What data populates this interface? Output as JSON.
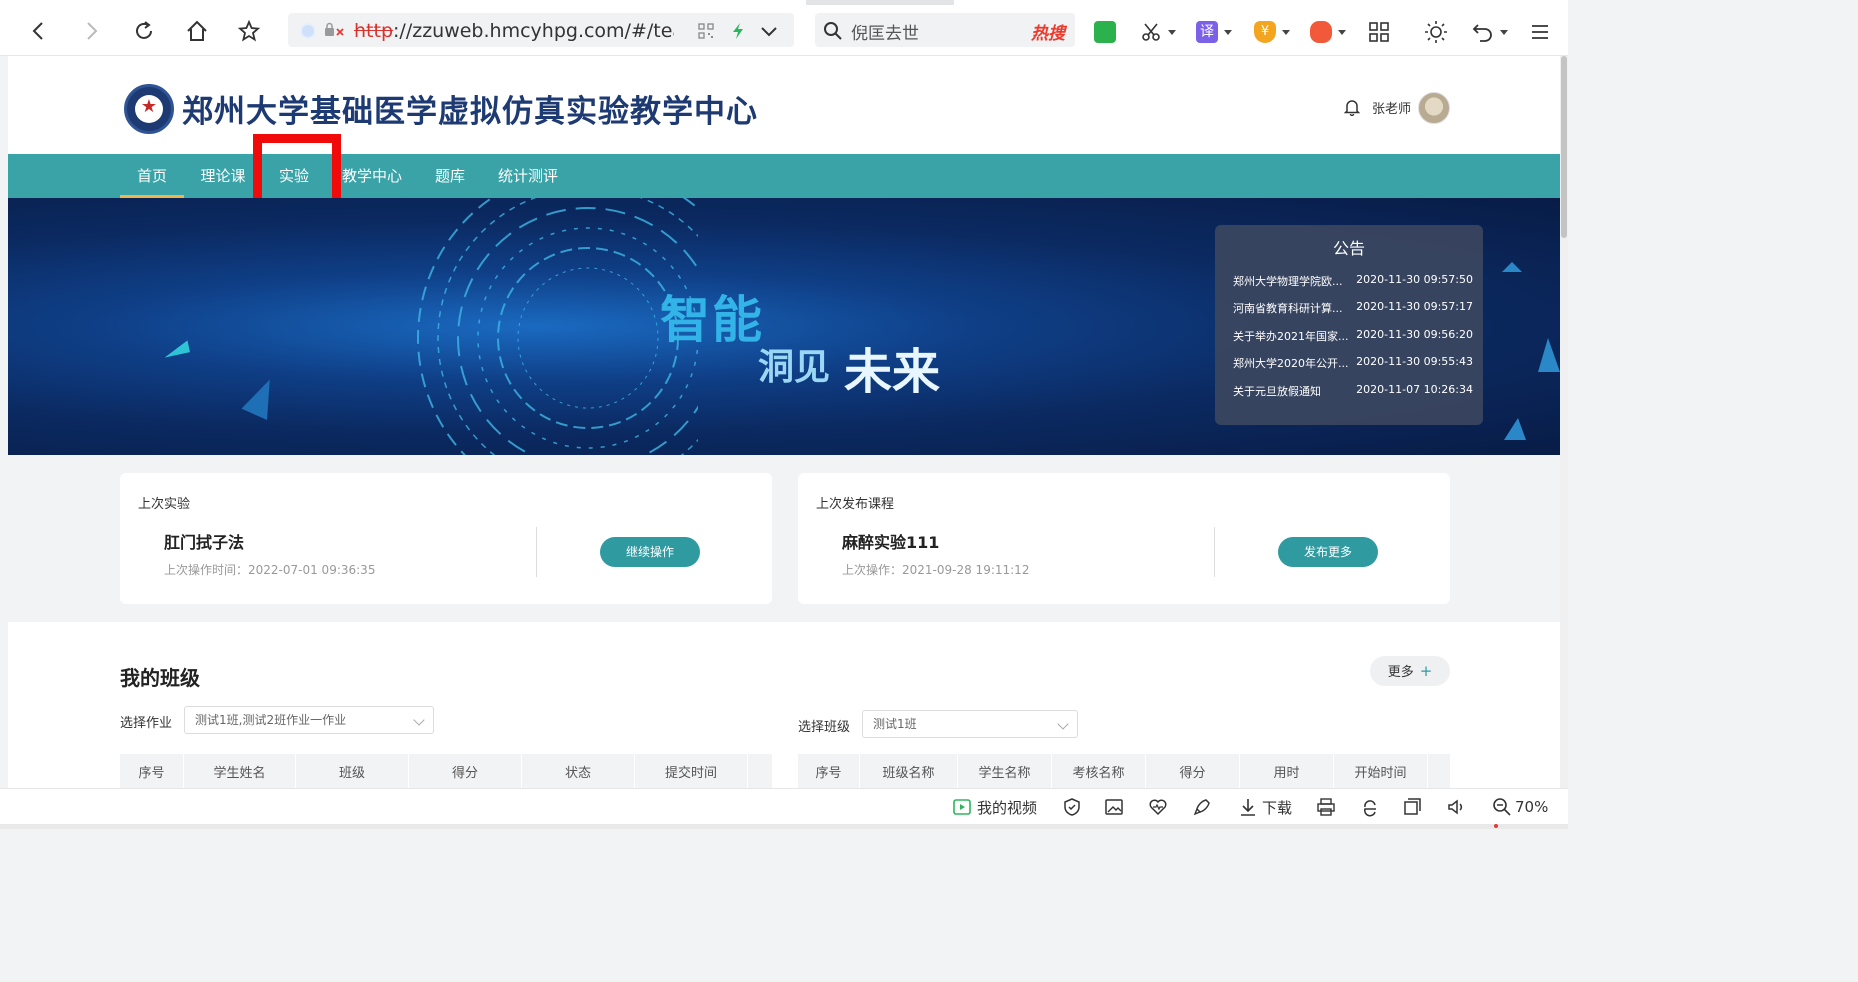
{
  "browser": {
    "url_protocol": "http",
    "url_rest": "://zzuweb.hmcyhpg.com/#/teache",
    "search_query": "倪匡去世",
    "hot_label": "热搜",
    "translate_label": "译",
    "coin_label": "¥"
  },
  "site": {
    "title": "郑州大学基础医学虚拟仿真实验教学中心",
    "username": "张老师"
  },
  "nav": {
    "items": [
      "首页",
      "理论课",
      "实验",
      "教学中心",
      "题库",
      "统计测评"
    ]
  },
  "banner": {
    "slogan_1": "智能",
    "slogan_2": "洞见",
    "slogan_3": "未来"
  },
  "notice": {
    "title": "公告",
    "items": [
      {
        "title": "郑州大学物理学院欧...",
        "time": "2020-11-30 09:57:50"
      },
      {
        "title": "河南省教育科研计算...",
        "time": "2020-11-30 09:57:17"
      },
      {
        "title": "关于举办2021年国家...",
        "time": "2020-11-30 09:56:20"
      },
      {
        "title": "郑州大学2020年公开...",
        "time": "2020-11-30 09:55:43"
      },
      {
        "title": "关于元旦放假通知",
        "time": "2020-11-07 10:26:34"
      }
    ]
  },
  "last_experiment": {
    "caption": "上次实验",
    "name": "肛门拭子法",
    "meta": "上次操作时间：2022-07-01 09:36:35",
    "button": "继续操作"
  },
  "last_course": {
    "caption": "上次发布课程",
    "name": "麻醉实验111",
    "meta": "上次操作：2021-09-28 19:11:12",
    "button": "发布更多"
  },
  "classes": {
    "heading": "我的班级",
    "more_label": "更多",
    "more_plus": "+",
    "left": {
      "label": "选择作业",
      "selected": "测试1班,测试2班作业一作业",
      "columns": [
        "序号",
        "学生姓名",
        "班级",
        "得分",
        "状态",
        "提交时间"
      ]
    },
    "right": {
      "label": "选择班级",
      "selected": "测试1班",
      "columns": [
        "序号",
        "班级名称",
        "学生名称",
        "考核名称",
        "得分",
        "用时",
        "开始时间"
      ]
    }
  },
  "statusbar": {
    "video_label": "我的视频",
    "download_label": "下载",
    "zoom": "70%"
  },
  "colors": {
    "nav_bg": "#3aa3a8",
    "nav_active_underline": "#f0b64b",
    "button_teal": "#2f9aa0",
    "highlight_red": "#f00a0a",
    "title_blue": "#1d3a73"
  }
}
